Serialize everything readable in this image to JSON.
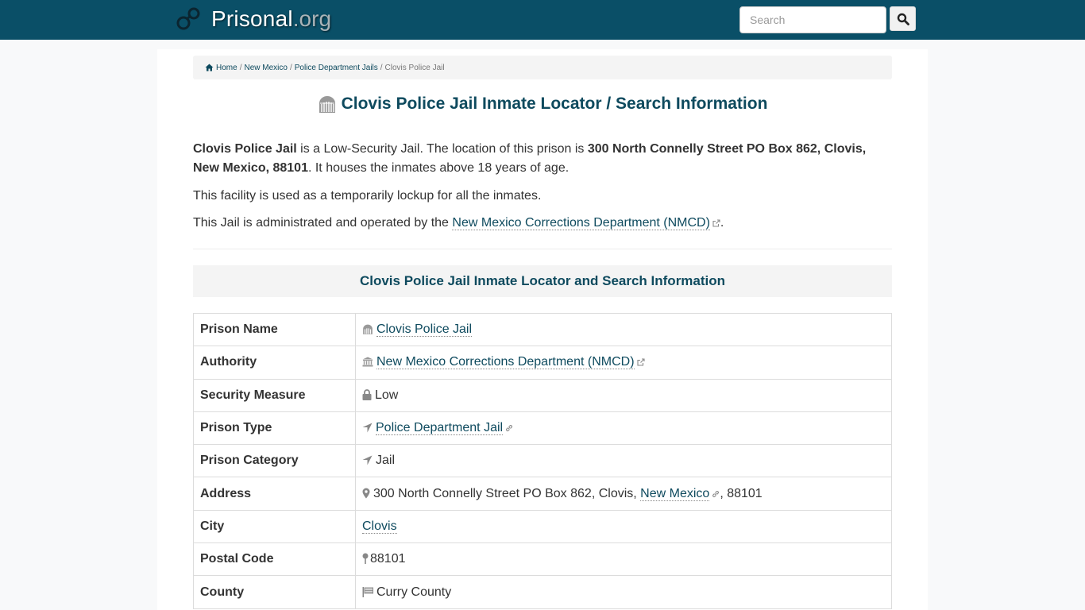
{
  "header": {
    "brand_name": "Prisonal",
    "brand_tld": ".org",
    "search_placeholder": "Search",
    "search_icon": "search-icon",
    "logo_icon": "handcuffs-icon"
  },
  "breadcrumb": {
    "items": [
      {
        "label": "Home",
        "icon": "home-icon"
      },
      {
        "label": "New Mexico"
      },
      {
        "label": "Police Department Jails"
      }
    ],
    "current": "Clovis Police Jail",
    "separator": "/"
  },
  "page_title": "Clovis Police Jail Inmate Locator / Search Information",
  "intro": {
    "p1": {
      "name": "Clovis Police Jail",
      "text1": " is a Low-Security Jail. The location of this prison is ",
      "address": "300 North Connelly Street PO Box 862, Clovis, New Mexico, 88101",
      "text2": ". It houses the inmates above 18 years of age."
    },
    "p2": "This facility is used as a temporarily lockup for all the inmates.",
    "p3": {
      "text": "This Jail is administrated and operated by the ",
      "link": "New Mexico Corrections Department (NMCD)",
      "end": "."
    }
  },
  "section_heading": "Clovis Police Jail Inmate Locator and Search Information",
  "table": {
    "rows": [
      {
        "label": "Prison Name",
        "value": "Clovis Police Jail",
        "icon": "jail-icon",
        "link": true
      },
      {
        "label": "Authority",
        "value": "New Mexico Corrections Department (NMCD)",
        "icon": "institution-icon",
        "link": true,
        "external": true
      },
      {
        "label": "Security Measure",
        "value": "Low",
        "icon": "lock-icon"
      },
      {
        "label": "Prison Type",
        "value": "Police Department Jail",
        "icon": "location-arrow-icon",
        "link": true,
        "chain": true
      },
      {
        "label": "Prison Category",
        "value": "Jail",
        "icon": "location-arrow-icon"
      },
      {
        "label": "Address",
        "value_pre": "300 North Connelly Street PO Box 862, Clovis, ",
        "value_link": "New Mexico",
        "value_post": ", 88101",
        "icon": "map-marker-icon"
      },
      {
        "label": "City",
        "value": "Clovis",
        "link": true
      },
      {
        "label": "Postal Code",
        "value": "88101",
        "icon": "map-pin-icon"
      },
      {
        "label": "County",
        "value": "Curry County",
        "icon": "flag-icon"
      }
    ]
  },
  "colors": {
    "navbar": "#0a4f67",
    "accent": "#0e4a5e",
    "panel": "#f4f4f4"
  }
}
